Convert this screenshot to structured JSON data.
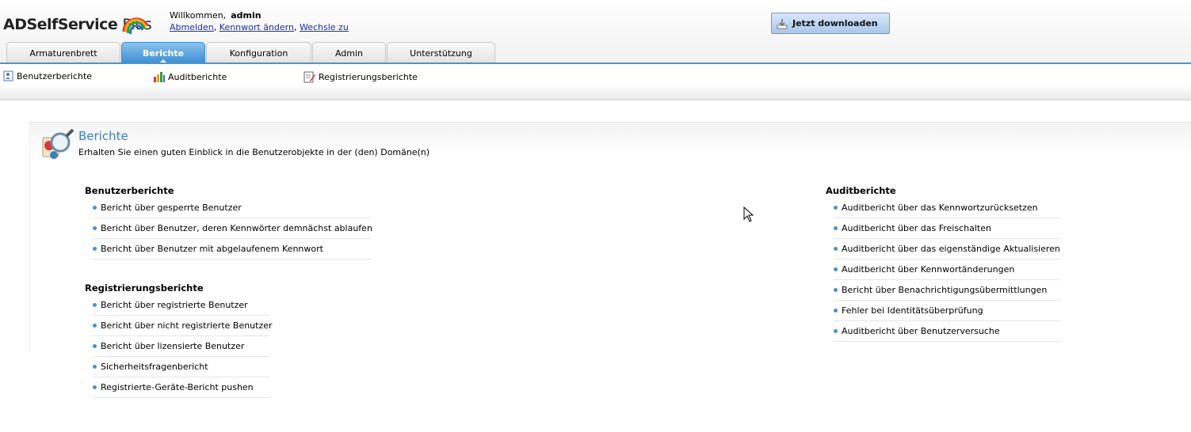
{
  "app": {
    "name": "ADSelfService",
    "name_suffix": "Plus"
  },
  "user": {
    "welcome": "Willkommen,",
    "name": "admin",
    "logout": "Abmelden",
    "change_password": "Kennwort ändern",
    "switch_to": "Wechsle zu"
  },
  "download_button": "Jetzt downloaden",
  "tabs": [
    {
      "label": "Armaturenbrett"
    },
    {
      "label": "Berichte"
    },
    {
      "label": "Konfiguration"
    },
    {
      "label": "Admin"
    },
    {
      "label": "Unterstützung"
    }
  ],
  "subnav": [
    {
      "label": "Benutzerberichte",
      "icon": "user-report-icon"
    },
    {
      "label": "Auditberichte",
      "icon": "bar-chart-icon"
    },
    {
      "label": "Registrierungsberichte",
      "icon": "registration-report-icon"
    }
  ],
  "page": {
    "title": "Berichte",
    "description": "Erhalten Sie einen guten Einblick in die Benutzerobjekte in der (den) Domäne(n)"
  },
  "sections": {
    "user_reports": {
      "title": "Benutzerberichte",
      "items": [
        "Bericht über gesperrte Benutzer",
        "Bericht über Benutzer, deren Kennwörter demnächst ablaufen",
        "Bericht über Benutzer mit abgelaufenem Kennwort"
      ]
    },
    "registration_reports": {
      "title": "Registrierungsberichte",
      "items": [
        "Bericht über registrierte Benutzer",
        "Bericht über nicht registrierte Benutzer",
        "Bericht über lizensierte Benutzer",
        "Sicherheitsfragenbericht",
        "Registrierte-Geräte-Bericht pushen"
      ]
    },
    "audit_reports": {
      "title": "Auditberichte",
      "items": [
        "Auditbericht über das Kennwortzurücksetzen",
        "Auditbericht über das Freischalten",
        "Auditbericht über das eigenständige Aktualisieren",
        "Auditbericht über Kennwortänderungen",
        "Bericht über Benachrichtigungsübermittlungen",
        "Fehler bei Identitätsüberprüfung",
        "Auditbericht über Benutzerversuche"
      ]
    }
  },
  "colors": {
    "accent": "#4b95d4",
    "title": "#3a7fc4",
    "link": "#1a2ea8"
  }
}
